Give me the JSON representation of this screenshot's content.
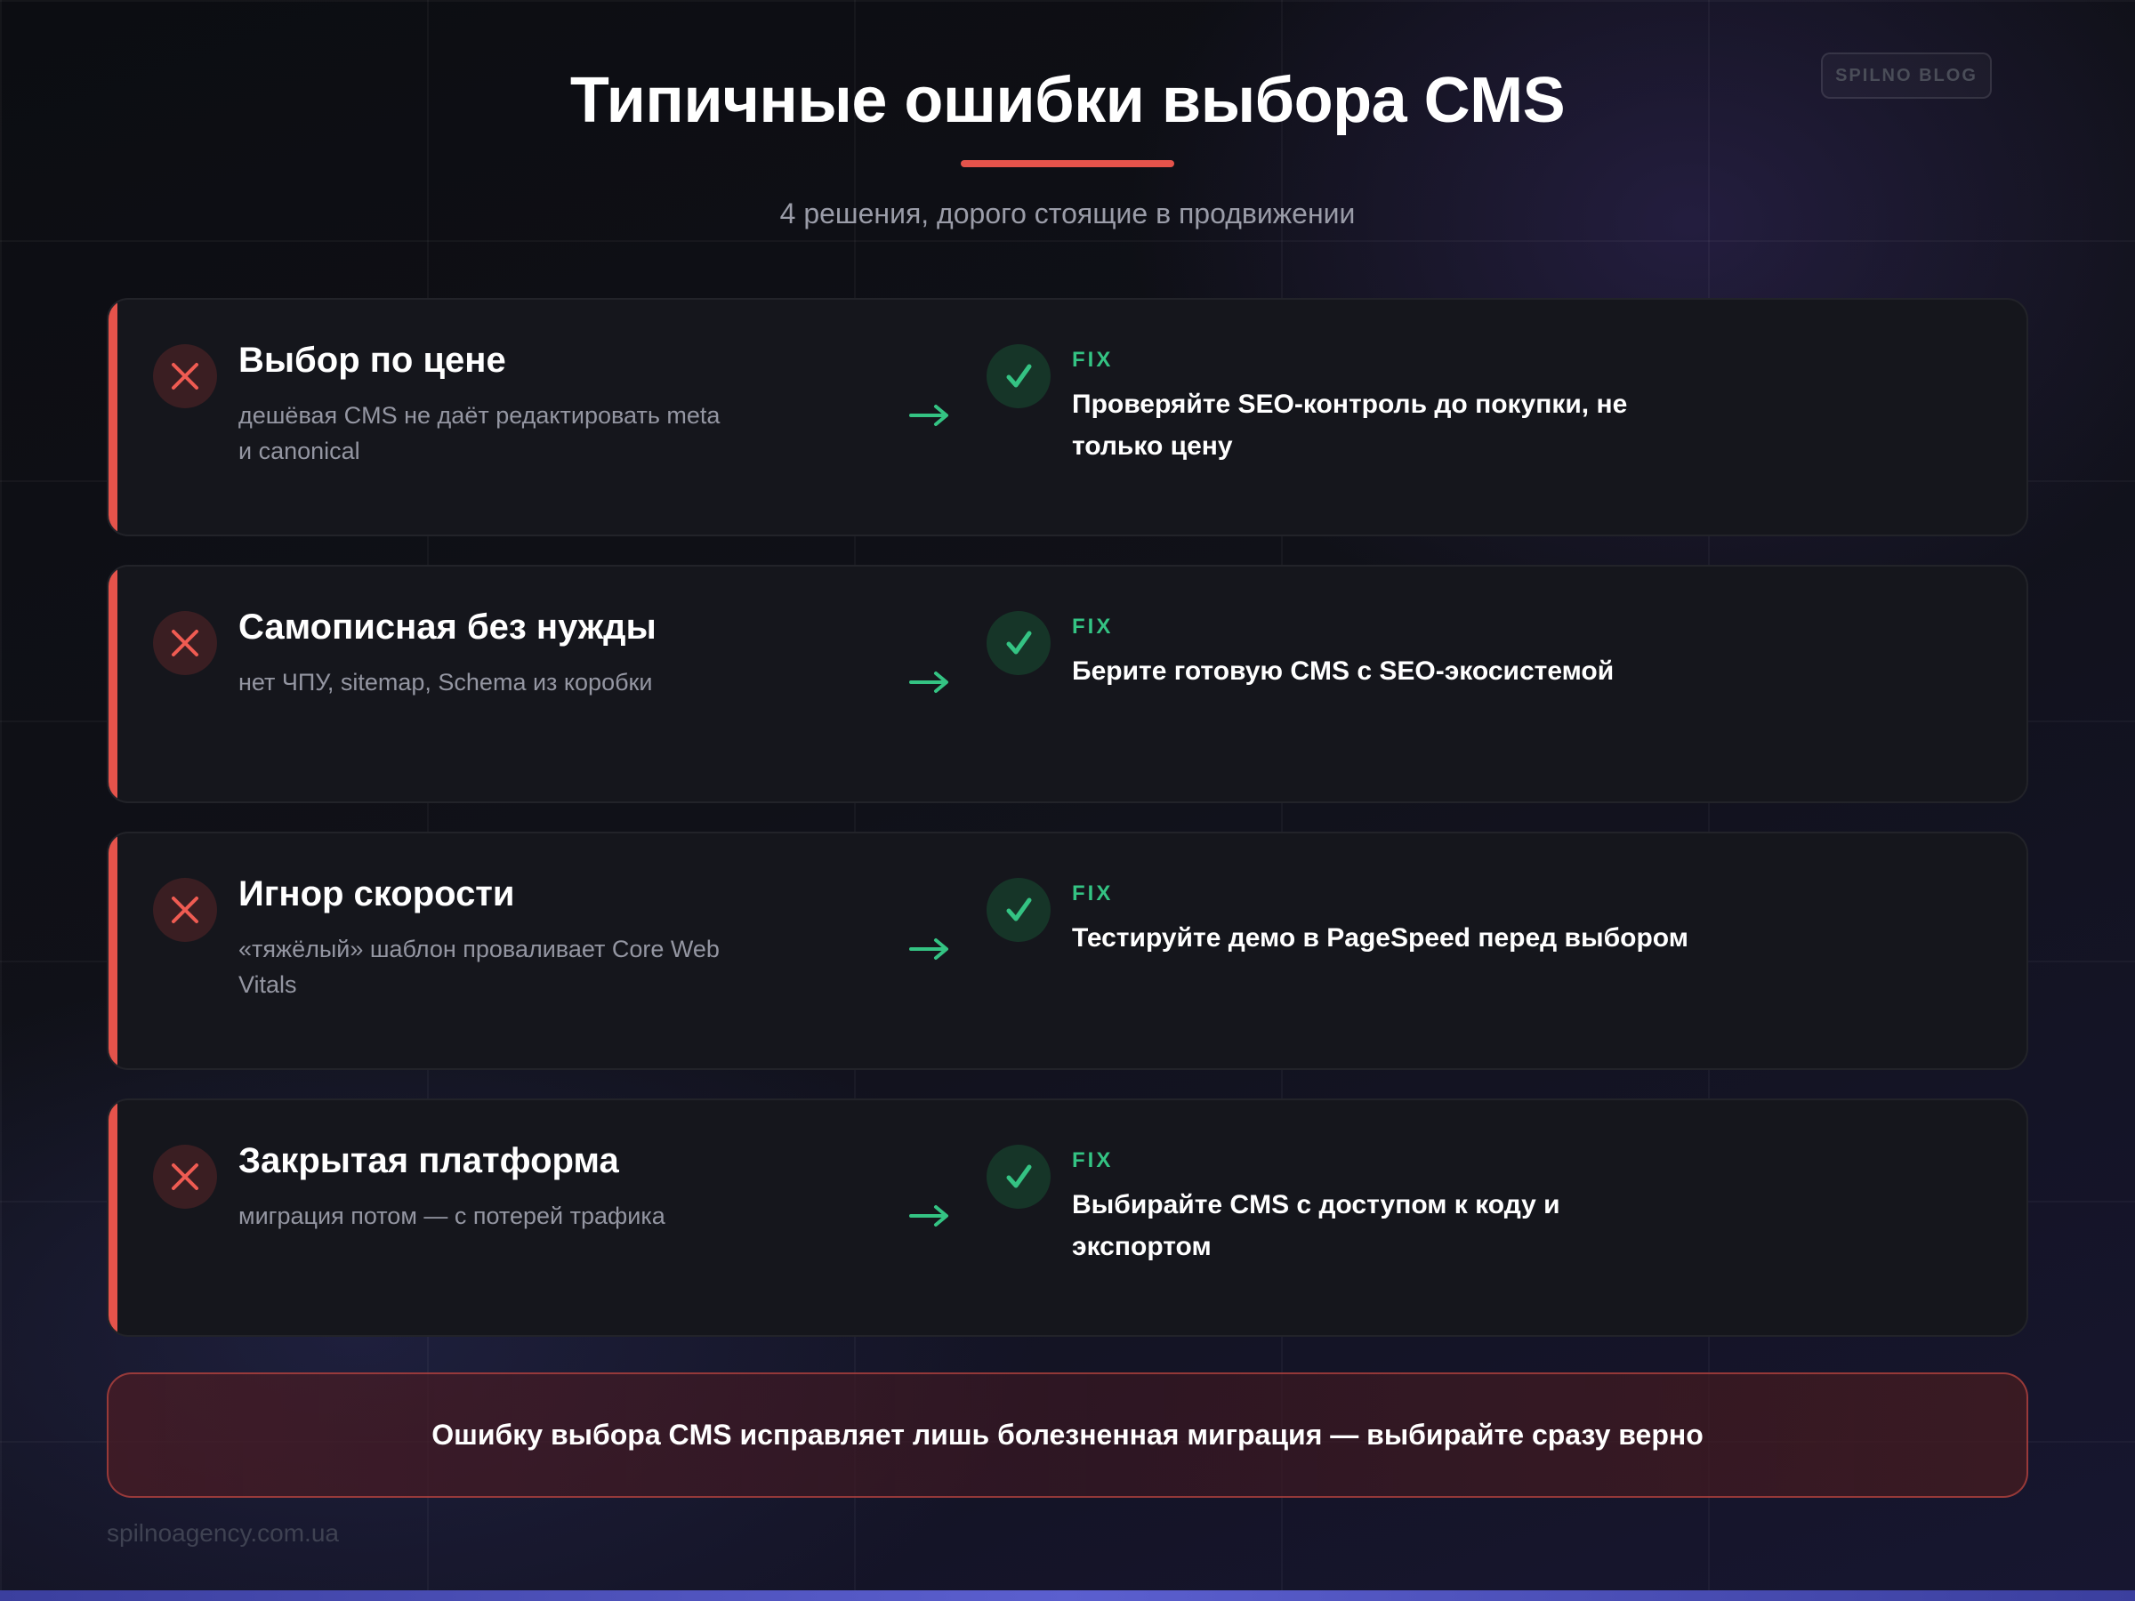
{
  "badge": "SPILNO BLOG",
  "header": {
    "title": "Типичные ошибки выбора CMS",
    "subtitle": "4 решения, дорого стоящие в продвижении"
  },
  "fix_label": "FIX",
  "cards": [
    {
      "title": "Выбор по цене",
      "description": "дешёвая CMS не даёт редактировать meta и canonical",
      "fix": "Проверяйте SEO-контроль до покупки, не только цену"
    },
    {
      "title": "Самописная без нужды",
      "description": "нет ЧПУ, sitemap, Schema из коробки",
      "fix": "Берите готовую CMS с SEO-экосистемой"
    },
    {
      "title": "Игнор скорости",
      "description": "«тяжёлый» шаблон проваливает Core Web Vitals",
      "fix": "Тестируйте демо в PageSpeed перед выбором"
    },
    {
      "title": "Закрытая платформа",
      "description": "миграция потом — с потерей трафика",
      "fix": "Выбирайте CMS с доступом к коду и экспортом"
    }
  ],
  "summary": "Ошибку выбора CMS исправляет лишь болезненная миграция — выбирайте сразу верно",
  "footer": "spilnoagency.com.ua",
  "colors": {
    "accent_red": "#e5534b",
    "accent_green": "#34c383",
    "card_bg": "#15161c",
    "page_bg": "#0c0d12"
  },
  "icons": {
    "mistake": "x-icon",
    "arrow": "arrow-right-icon",
    "fix": "checkmark-icon"
  }
}
